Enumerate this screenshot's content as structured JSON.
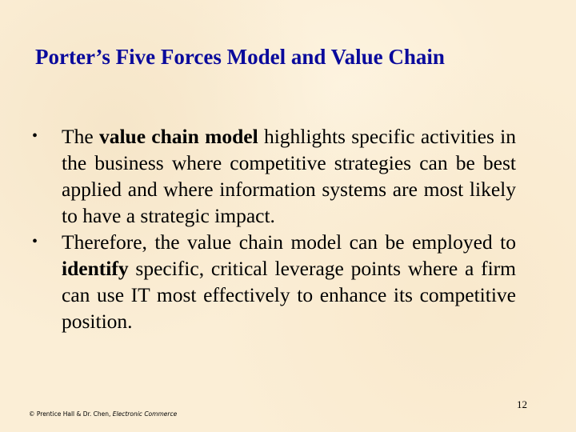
{
  "slide": {
    "title": "Porter’s Five Forces Model and Value Chain",
    "bullet_glyph": "•",
    "bullets": [
      {
        "before": "The ",
        "bold": "value chain model",
        "after": " highlights specific activities in the business where competitive strategies can be best applied and where information systems are most likely to have a strategic impact."
      },
      {
        "before": "Therefore, the value chain model can be employed to ",
        "bold": "identify",
        "after": " specific, critical leverage points where a firm can use IT most effectively to enhance its competitive position."
      }
    ],
    "footer": {
      "copyright": "© Prentice Hall & Dr. Chen, ",
      "book": "Electronic Commerce"
    },
    "page_number": "12"
  },
  "colors": {
    "background": "#fbeed6",
    "title": "#0a0a9c",
    "text": "#000000"
  }
}
